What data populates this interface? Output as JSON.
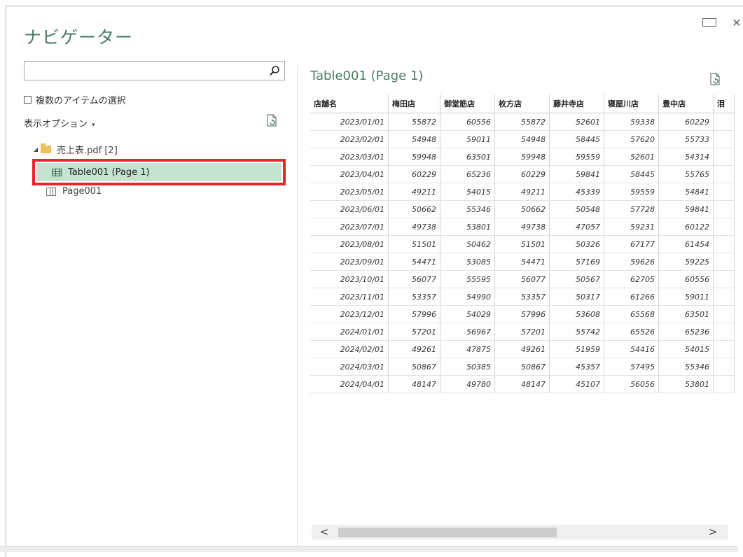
{
  "window": {
    "maximize_icon": "maximize-icon",
    "close_label": "✕"
  },
  "navigator": {
    "title": "ナビゲーター",
    "search": {
      "value": "",
      "placeholder": ""
    },
    "multi_select_label": "複数のアイテムの選択",
    "display_options_label": "表示オプション",
    "tree": {
      "file": {
        "label": "売上表.pdf [2]",
        "expanded": true
      },
      "items": [
        {
          "label": "Table001 (Page 1)",
          "icon": "table-icon",
          "selected": true
        },
        {
          "label": "Page001",
          "icon": "page-icon",
          "selected": false
        }
      ]
    }
  },
  "preview": {
    "title": "Table001 (Page 1)",
    "columns": [
      "店舗名",
      "梅田店",
      "御堂筋店",
      "枚方店",
      "藤井寺店",
      "寝屋川店",
      "豊中店",
      "泪"
    ],
    "rows": [
      [
        "2023/01/01",
        "55872",
        "60556",
        "55872",
        "52601",
        "59338",
        "60229",
        ""
      ],
      [
        "2023/02/01",
        "54948",
        "59011",
        "54948",
        "58445",
        "57620",
        "55733",
        ""
      ],
      [
        "2023/03/01",
        "59948",
        "63501",
        "59948",
        "59559",
        "52601",
        "54314",
        ""
      ],
      [
        "2023/04/01",
        "60229",
        "65236",
        "60229",
        "59841",
        "58445",
        "55765",
        ""
      ],
      [
        "2023/05/01",
        "49211",
        "54015",
        "49211",
        "45339",
        "59559",
        "54841",
        ""
      ],
      [
        "2023/06/01",
        "50662",
        "55346",
        "50662",
        "50548",
        "57728",
        "59841",
        ""
      ],
      [
        "2023/07/01",
        "49738",
        "53801",
        "49738",
        "47057",
        "59231",
        "60122",
        ""
      ],
      [
        "2023/08/01",
        "51501",
        "50462",
        "51501",
        "50326",
        "67177",
        "61454",
        ""
      ],
      [
        "2023/09/01",
        "54471",
        "53085",
        "54471",
        "57169",
        "59626",
        "59225",
        ""
      ],
      [
        "2023/10/01",
        "56077",
        "55595",
        "56077",
        "50567",
        "62705",
        "60556",
        ""
      ],
      [
        "2023/11/01",
        "53357",
        "54990",
        "53357",
        "50317",
        "61266",
        "59011",
        ""
      ],
      [
        "2023/12/01",
        "57996",
        "54029",
        "57996",
        "53608",
        "65568",
        "63501",
        ""
      ],
      [
        "2024/01/01",
        "57201",
        "56967",
        "57201",
        "55742",
        "65526",
        "65236",
        ""
      ],
      [
        "2024/02/01",
        "49261",
        "47875",
        "49261",
        "51959",
        "54416",
        "54015",
        ""
      ],
      [
        "2024/03/01",
        "50867",
        "50385",
        "50867",
        "45357",
        "57495",
        "55346",
        ""
      ],
      [
        "2024/04/01",
        "48147",
        "49780",
        "48147",
        "45107",
        "56056",
        "53801",
        ""
      ]
    ]
  },
  "scrollbar": {
    "left_arrow": "<",
    "right_arrow": ">"
  }
}
